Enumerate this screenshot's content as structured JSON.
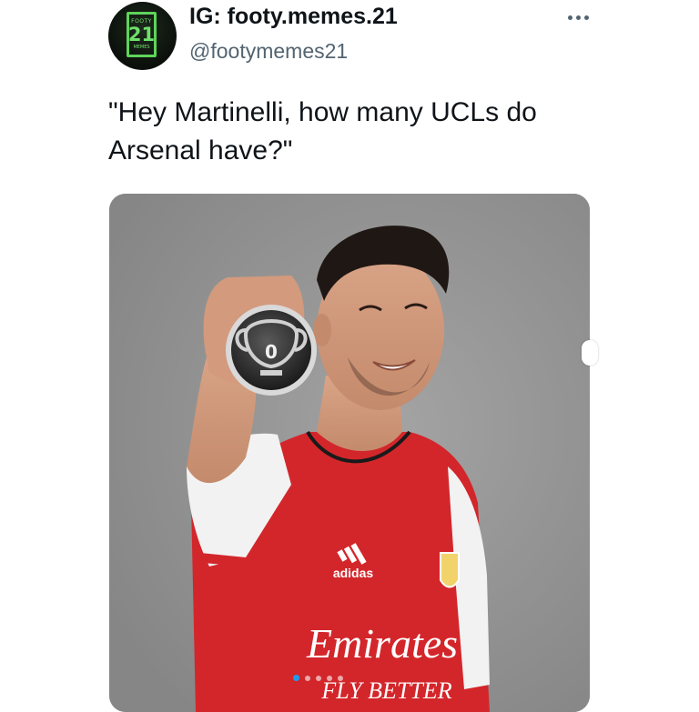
{
  "tweet": {
    "avatar": {
      "badge_top": "FOOTY",
      "badge_number": "21",
      "badge_bottom": "MEMES"
    },
    "display_name": "IG: footy.memes.21",
    "handle": "@footymemes21",
    "text": "\"Hey Martinelli, how many UCLs do Arsenal have?\"",
    "media": {
      "medal_number": "0",
      "shirt_brand": "adidas",
      "shirt_sponsor": "Emirates",
      "shirt_sponsor_line2": "FLY BETTER"
    },
    "pager": {
      "count": 5,
      "active_index": 0
    }
  },
  "colors": {
    "text_primary": "#0f1419",
    "text_secondary": "#536471",
    "shirt_red": "#d3262b",
    "background_grey": "#8f8f8f",
    "accent_blue": "#1d9bf0"
  }
}
